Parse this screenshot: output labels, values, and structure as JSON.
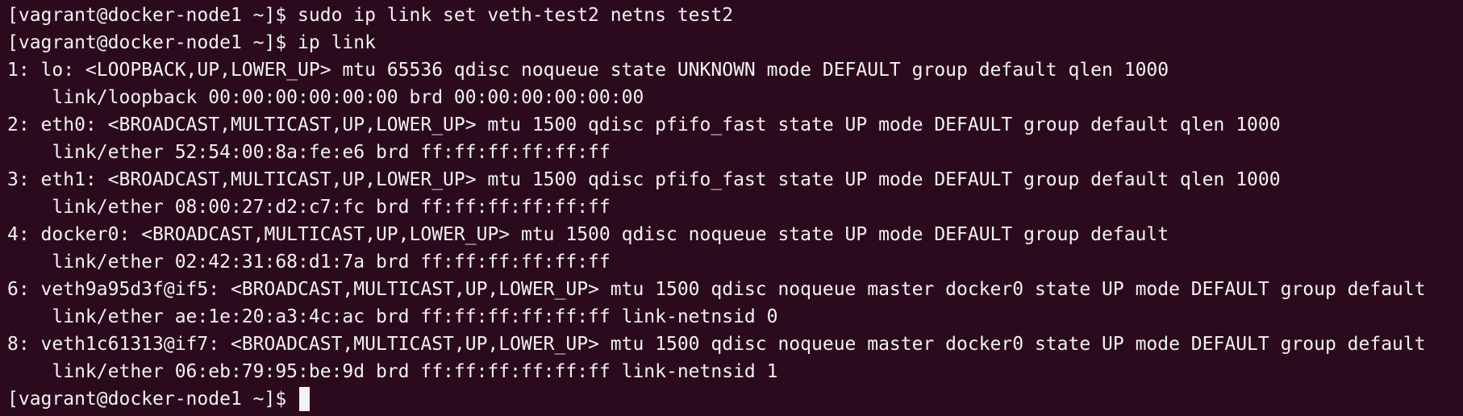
{
  "terminal": {
    "lines": [
      "[vagrant@docker-node1 ~]$ sudo ip link set veth-test2 netns test2",
      "[vagrant@docker-node1 ~]$ ip link",
      "1: lo: <LOOPBACK,UP,LOWER_UP> mtu 65536 qdisc noqueue state UNKNOWN mode DEFAULT group default qlen 1000",
      "    link/loopback 00:00:00:00:00:00 brd 00:00:00:00:00:00",
      "2: eth0: <BROADCAST,MULTICAST,UP,LOWER_UP> mtu 1500 qdisc pfifo_fast state UP mode DEFAULT group default qlen 1000",
      "    link/ether 52:54:00:8a:fe:e6 brd ff:ff:ff:ff:ff:ff",
      "3: eth1: <BROADCAST,MULTICAST,UP,LOWER_UP> mtu 1500 qdisc pfifo_fast state UP mode DEFAULT group default qlen 1000",
      "    link/ether 08:00:27:d2:c7:fc brd ff:ff:ff:ff:ff:ff",
      "4: docker0: <BROADCAST,MULTICAST,UP,LOWER_UP> mtu 1500 qdisc noqueue state UP mode DEFAULT group default",
      "    link/ether 02:42:31:68:d1:7a brd ff:ff:ff:ff:ff:ff",
      "6: veth9a95d3f@if5: <BROADCAST,MULTICAST,UP,LOWER_UP> mtu 1500 qdisc noqueue master docker0 state UP mode DEFAULT group default",
      "    link/ether ae:1e:20:a3:4c:ac brd ff:ff:ff:ff:ff:ff link-netnsid 0",
      "8: veth1c61313@if7: <BROADCAST,MULTICAST,UP,LOWER_UP> mtu 1500 qdisc noqueue master docker0 state UP mode DEFAULT group default",
      "    link/ether 06:eb:79:95:be:9d brd ff:ff:ff:ff:ff:ff link-netnsid 1"
    ],
    "prompt": "[vagrant@docker-node1 ~]$ ",
    "colors": {
      "background": "#2c0a1e",
      "foreground": "#f2f2f2"
    }
  }
}
